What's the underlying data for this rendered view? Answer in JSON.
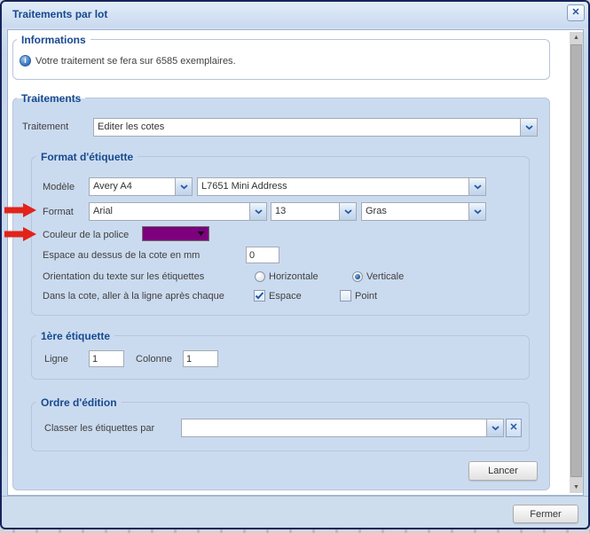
{
  "window": {
    "title": "Traitements par lot"
  },
  "icons": {
    "close": "✕",
    "clear": "✕",
    "info": "i",
    "scroll_up": "▲",
    "scroll_down": "▼"
  },
  "informations": {
    "legend": "Informations",
    "message": "Votre traitement se fera sur 6585 exemplaires."
  },
  "traitements": {
    "legend": "Traitements",
    "traitement": {
      "label": "Traitement",
      "value": "Editer les cotes"
    },
    "format_etiquette": {
      "legend": "Format d'étiquette",
      "modele": {
        "label": "Modèle",
        "brand": "Avery A4",
        "model": "L7651 Mini Address"
      },
      "format": {
        "label": "Format",
        "font": "Arial",
        "size": "13",
        "style": "Gras"
      },
      "couleur": {
        "label": "Couleur de la police",
        "value": "#7d017d"
      },
      "espace_cote": {
        "label": "Espace au dessus de la cote en mm",
        "value": "0"
      },
      "orientation": {
        "label": "Orientation du texte sur les étiquettes",
        "horizontale": "Horizontale",
        "horizontale_selected": false,
        "verticale": "Verticale",
        "verticale_selected": true
      },
      "retour_ligne": {
        "label": "Dans la cote, aller à la ligne après chaque",
        "espace": "Espace",
        "espace_checked": true,
        "point": "Point",
        "point_checked": false
      }
    },
    "premiere_etiquette": {
      "legend": "1ère étiquette",
      "ligne_label": "Ligne",
      "ligne_value": "1",
      "colonne_label": "Colonne",
      "colonne_value": "1"
    },
    "ordre_edition": {
      "legend": "Ordre d'édition",
      "label": "Classer les étiquettes par",
      "value": ""
    },
    "lancer": "Lancer"
  },
  "footer": {
    "fermer": "Fermer"
  },
  "annotation": {
    "arrow_color": "#e2231a"
  }
}
